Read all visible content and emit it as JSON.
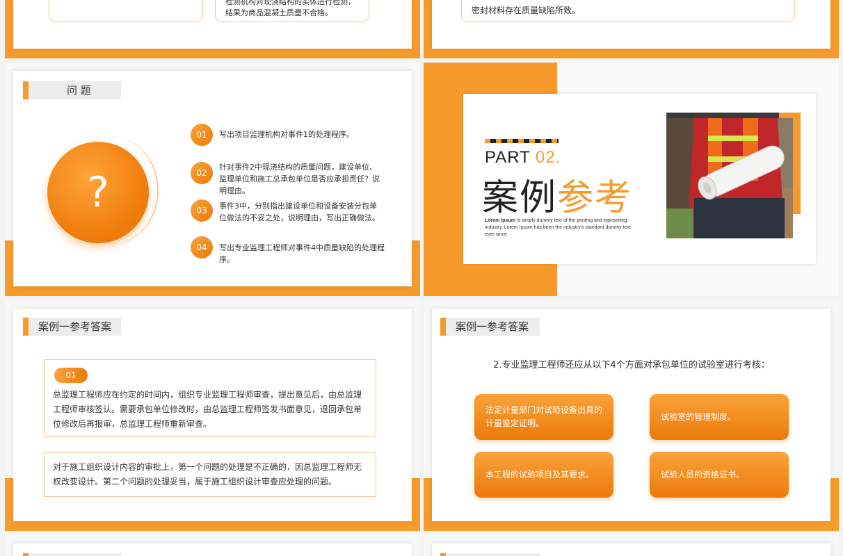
{
  "slide_top_left": {
    "box_right_text": "检测机构对现浇结构的实体进行检测，结果为商品混凝土质量不合格。"
  },
  "slide_top_right": {
    "text": "密封材料存在质量缺陷所致。"
  },
  "problem_slide": {
    "tag": "问 题",
    "circle_symbol": "?",
    "items": [
      {
        "num": "01",
        "text": "写出项目监理机构对事件1的处理程序。"
      },
      {
        "num": "02",
        "text": "针对事件2中现浇结构的质量问题，建设单位、监理单位和施工总承包单位是否应承担责任？说明理由。"
      },
      {
        "num": "03",
        "text": "事件3中，分别指出建设单位和设备安装分包单位做法的不妥之处，说明理由，写出正确做法。"
      },
      {
        "num": "04",
        "text": "写出专业监理工程师对事件4中质量缺陷的处理程序。"
      }
    ]
  },
  "part_slide": {
    "part_word": "PART",
    "part_number": "02.",
    "title_dark": "案例",
    "title_light": "参考",
    "lorem_bold": "Lorem Ipsum",
    "lorem_rest": " is simply dummy text of the printing and typesetting industry. Lorem Ipsum has been the industry's standard dummy text ever since"
  },
  "answer_slide_1": {
    "tag": "案例一参考答案",
    "pill": "01",
    "para1": "总监理工程师应在约定的时间内，组织专业监理工程师审查，提出意见后，由总监理工程师审核签认。需要承包单位修改时，由总监理工程师签发书面意见，退回承包单位修改后再报审，总监理工程师重新审查。",
    "para2": "对于施工组织设计内容的审批上，第一个问题的处理是不正确的，因总监理工程师无权改变设计。第二个问题的处理妥当，属于施工组织设计审查应处理的问题。"
  },
  "answer_slide_2": {
    "tag": "案例一参考答案",
    "heading": "2.专业监理工程师还应从以下4个方面对承包单位的试验室进行考核：",
    "buttons": [
      "法定计量部门对试验设备出具的计量鉴定证明。",
      "试验室的管理制度。",
      "本工程的试验项目及其要求。",
      "试验人员的资格证书。"
    ]
  },
  "colors": {
    "accent": "#f79a2c",
    "accent_dark": "#ec7a0a",
    "text": "#333333"
  }
}
